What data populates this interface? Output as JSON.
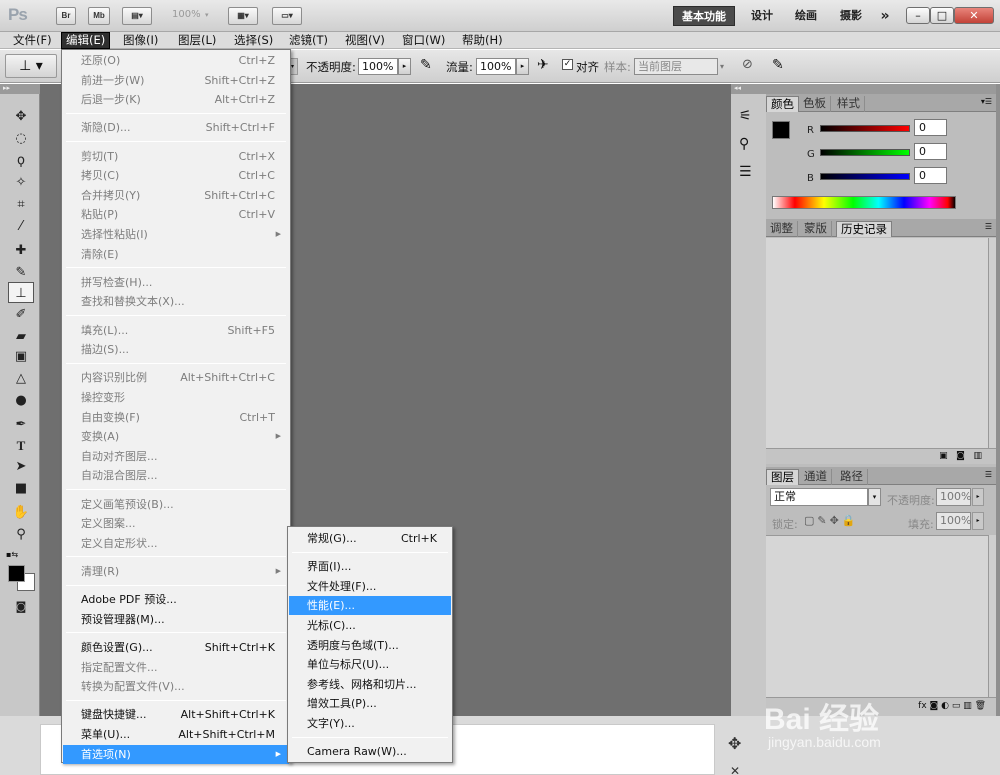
{
  "app": {
    "logo": "Ps",
    "bridge_label": "Br",
    "minibridge_label": "Mb",
    "zoom": "100%",
    "workspaces": [
      "基本功能",
      "设计",
      "绘画",
      "摄影"
    ],
    "overflow_symbol": "»",
    "window_buttons": [
      "–",
      "□",
      "✕"
    ]
  },
  "menubar": [
    "文件(F)",
    "编辑(E)",
    "图像(I)",
    "图层(L)",
    "选择(S)",
    "滤镜(T)",
    "视图(V)",
    "窗口(W)",
    "帮助(H)"
  ],
  "options_bar": {
    "opacity_label": "不透明度:",
    "opacity_value": "100%",
    "flow_label": "流量:",
    "flow_value": "100%",
    "align_label": "对齐",
    "align_checked": true,
    "sample_label": "样本:",
    "sample_value": "当前图层"
  },
  "edit_menu": [
    {
      "label": "还原(O)",
      "shortcut": "Ctrl+Z",
      "disabled": true
    },
    {
      "label": "前进一步(W)",
      "shortcut": "Shift+Ctrl+Z",
      "disabled": true
    },
    {
      "label": "后退一步(K)",
      "shortcut": "Alt+Ctrl+Z",
      "disabled": true
    },
    {
      "sep": true
    },
    {
      "label": "渐隐(D)...",
      "shortcut": "Shift+Ctrl+F",
      "disabled": true
    },
    {
      "sep": true
    },
    {
      "label": "剪切(T)",
      "shortcut": "Ctrl+X",
      "disabled": true
    },
    {
      "label": "拷贝(C)",
      "shortcut": "Ctrl+C",
      "disabled": true
    },
    {
      "label": "合并拷贝(Y)",
      "shortcut": "Shift+Ctrl+C",
      "disabled": true
    },
    {
      "label": "粘贴(P)",
      "shortcut": "Ctrl+V",
      "disabled": true
    },
    {
      "label": "选择性粘贴(I)",
      "shortcut": "",
      "disabled": true,
      "submenu": true
    },
    {
      "label": "清除(E)",
      "shortcut": "",
      "disabled": true
    },
    {
      "sep": true
    },
    {
      "label": "拼写检查(H)...",
      "shortcut": "",
      "disabled": true
    },
    {
      "label": "查找和替换文本(X)...",
      "shortcut": "",
      "disabled": true
    },
    {
      "sep": true
    },
    {
      "label": "填充(L)...",
      "shortcut": "Shift+F5",
      "disabled": true
    },
    {
      "label": "描边(S)...",
      "shortcut": "",
      "disabled": true
    },
    {
      "sep": true
    },
    {
      "label": "内容识别比例",
      "shortcut": "Alt+Shift+Ctrl+C",
      "disabled": true
    },
    {
      "label": "操控变形",
      "shortcut": "",
      "disabled": true
    },
    {
      "label": "自由变换(F)",
      "shortcut": "Ctrl+T",
      "disabled": true
    },
    {
      "label": "变换(A)",
      "shortcut": "",
      "disabled": true,
      "submenu": true
    },
    {
      "label": "自动对齐图层...",
      "shortcut": "",
      "disabled": true
    },
    {
      "label": "自动混合图层...",
      "shortcut": "",
      "disabled": true
    },
    {
      "sep": true
    },
    {
      "label": "定义画笔预设(B)...",
      "shortcut": "",
      "disabled": true
    },
    {
      "label": "定义图案...",
      "shortcut": "",
      "disabled": true
    },
    {
      "label": "定义自定形状...",
      "shortcut": "",
      "disabled": true
    },
    {
      "sep": true
    },
    {
      "label": "清理(R)",
      "shortcut": "",
      "disabled": true,
      "submenu": true
    },
    {
      "sep": true
    },
    {
      "label": "Adobe PDF 预设...",
      "shortcut": "",
      "disabled": false
    },
    {
      "label": "预设管理器(M)...",
      "shortcut": "",
      "disabled": false
    },
    {
      "sep": true
    },
    {
      "label": "颜色设置(G)...",
      "shortcut": "Shift+Ctrl+K",
      "disabled": false
    },
    {
      "label": "指定配置文件...",
      "shortcut": "",
      "disabled": true
    },
    {
      "label": "转换为配置文件(V)...",
      "shortcut": "",
      "disabled": true
    },
    {
      "sep": true
    },
    {
      "label": "键盘快捷键...",
      "shortcut": "Alt+Shift+Ctrl+K",
      "disabled": false
    },
    {
      "label": "菜单(U)...",
      "shortcut": "Alt+Shift+Ctrl+M",
      "disabled": false
    },
    {
      "label": "首选项(N)",
      "shortcut": "",
      "disabled": false,
      "submenu": true,
      "highlight": true
    }
  ],
  "prefs_menu": [
    {
      "label": "常规(G)...",
      "shortcut": "Ctrl+K"
    },
    {
      "sep": true
    },
    {
      "label": "界面(I)..."
    },
    {
      "label": "文件处理(F)..."
    },
    {
      "label": "性能(E)...",
      "highlight": true
    },
    {
      "label": "光标(C)..."
    },
    {
      "label": "透明度与色域(T)..."
    },
    {
      "label": "单位与标尺(U)..."
    },
    {
      "label": "参考线、网格和切片..."
    },
    {
      "label": "增效工具(P)..."
    },
    {
      "label": "文字(Y)..."
    },
    {
      "sep": true
    },
    {
      "label": "Camera Raw(W)..."
    }
  ],
  "color_panel": {
    "tabs": [
      "颜色",
      "色板",
      "样式"
    ],
    "channels": [
      {
        "name": "R",
        "value": "0",
        "color": "#ff0000"
      },
      {
        "name": "G",
        "value": "0",
        "color": "#00ff00"
      },
      {
        "name": "B",
        "value": "0",
        "color": "#0000ff"
      }
    ]
  },
  "history_panel": {
    "tabs": [
      "调整",
      "蒙版",
      "历史记录"
    ]
  },
  "layers_panel": {
    "tabs": [
      "图层",
      "通道",
      "路径"
    ],
    "blend_mode": "正常",
    "opacity_label": "不透明度:",
    "opacity_value": "100%",
    "lock_label": "锁定:",
    "fill_label": "填充:",
    "fill_value": "100%"
  },
  "watermark": {
    "text": "Bai 经验",
    "url": "jingyan.baidu.com"
  }
}
